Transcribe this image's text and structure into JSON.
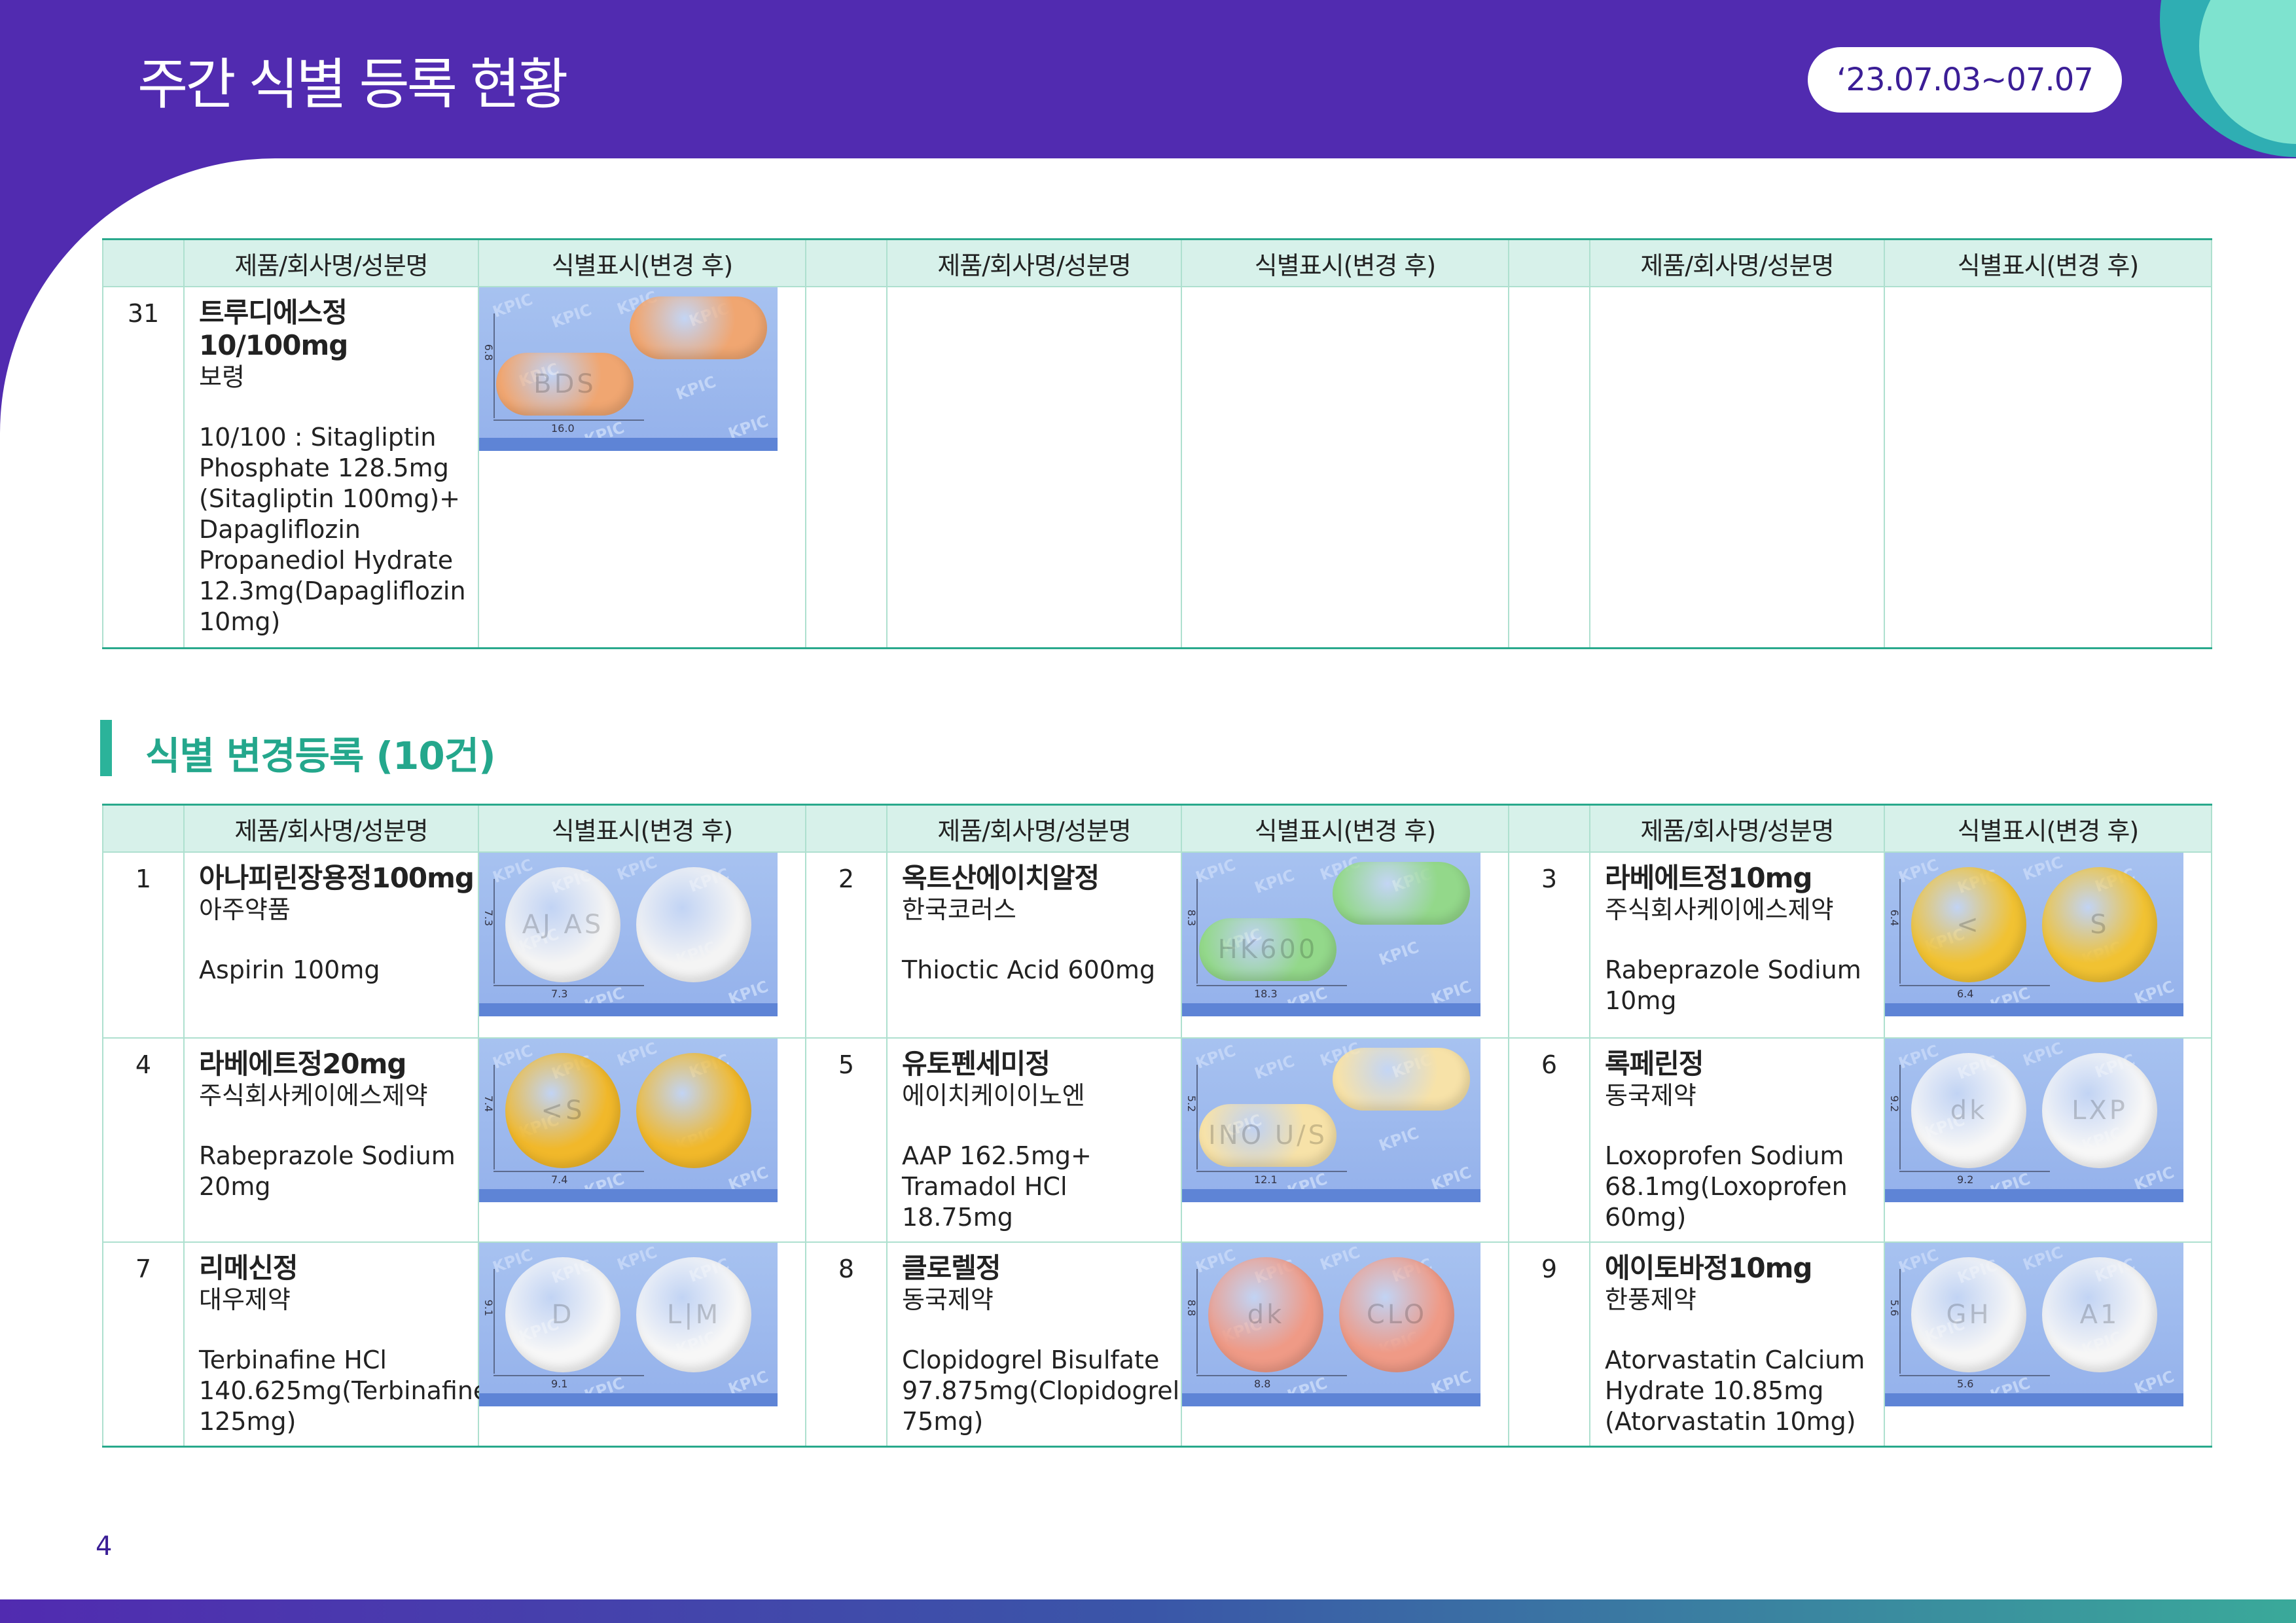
{
  "header": {
    "title": "주간 식별 등록 현황",
    "date_range": "‘23.07.03~07.07"
  },
  "columns": {
    "product": "제품/회사명/성분명",
    "marking": "식별표시(변경 후)"
  },
  "table1": {
    "rows": [
      {
        "num": "31",
        "name": "트루디에스정 10/100mg",
        "company": "보령",
        "ingredient": "10/100 : Sitagliptin Phosphate 128.5mg (Sitagliptin 100mg)+ Dapagliflozin Propanediol Hydrate 12.3mg(Dapagliflozin 10mg)",
        "photo": {
          "height_label": "6.8",
          "length_label": "16.0",
          "front_mark": "BDS",
          "back_mark": "",
          "shape": "oval",
          "color": "#f0a671"
        }
      }
    ]
  },
  "section2": {
    "title": "식별 변경등록 (10건)"
  },
  "table2": {
    "rows": [
      [
        {
          "num": "1",
          "name": "아나피린장용정100mg",
          "company": "아주약품",
          "ingredient": "Aspirin 100mg",
          "photo": {
            "height_label": "7.3",
            "length_label": "7.3",
            "front_mark": "AJ AS",
            "back_mark": "",
            "shape": "round",
            "color": "#f4f4f4"
          }
        },
        {
          "num": "2",
          "name": "옥트산에이치알정",
          "company": "한국코러스",
          "ingredient": "Thioctic Acid 600mg",
          "photo": {
            "height_label": "8.3",
            "length_label": "18.3",
            "front_mark": "HK600",
            "back_mark": "",
            "shape": "oval",
            "color": "#93d88a"
          }
        },
        {
          "num": "3",
          "name": "라베에트정10mg",
          "company": "주식회사케이에스제약",
          "ingredient": "Rabeprazole Sodium 10mg",
          "photo": {
            "height_label": "6.4",
            "length_label": "6.4",
            "front_mark": "<",
            "back_mark": "S",
            "shape": "round",
            "color": "#f1c232"
          }
        }
      ],
      [
        {
          "num": "4",
          "name": "라베에트정20mg",
          "company": "주식회사케이에스제약",
          "ingredient": "Rabeprazole Sodium 20mg",
          "photo": {
            "height_label": "7.4",
            "length_label": "7.4",
            "front_mark": "<S",
            "back_mark": "",
            "shape": "round",
            "color": "#f1b82a"
          }
        },
        {
          "num": "5",
          "name": "유토펜세미정",
          "company": "에이치케이이노엔",
          "ingredient": "AAP 162.5mg+ Tramadol HCl 18.75mg",
          "photo": {
            "height_label": "5.2",
            "length_label": "12.1",
            "front_mark": "INO U/S",
            "back_mark": "",
            "shape": "oval",
            "color": "#f7e2a8"
          }
        },
        {
          "num": "6",
          "name": "록페린정",
          "company": "동국제약",
          "ingredient": "Loxoprofen Sodium 68.1mg(Loxoprofen 60mg)",
          "photo": {
            "height_label": "9.2",
            "length_label": "9.2",
            "front_mark": "dk",
            "back_mark": "LXP",
            "shape": "round",
            "color": "#f7f7f7"
          }
        }
      ],
      [
        {
          "num": "7",
          "name": "리메신정",
          "company": "대우제약",
          "ingredient": "Terbinafine HCl 140.625mg(Terbinafine 125mg)",
          "photo": {
            "height_label": "9.1",
            "length_label": "9.1",
            "front_mark": "D",
            "back_mark": "L|M",
            "shape": "round",
            "color": "#f7f7f7"
          }
        },
        {
          "num": "8",
          "name": "클로렐정",
          "company": "동국제약",
          "ingredient": "Clopidogrel Bisulfate 97.875mg(Clopidogrel 75mg)",
          "photo": {
            "height_label": "8.8",
            "length_label": "8.8",
            "front_mark": "dk",
            "back_mark": "CLO",
            "shape": "round",
            "color": "#ef9a86"
          }
        },
        {
          "num": "9",
          "name": "에이토바정10mg",
          "company": "한풍제약",
          "ingredient": "Atorvastatin Calcium Hydrate 10.85mg (Atorvastatin 10mg)",
          "photo": {
            "height_label": "5.6",
            "length_label": "5.6",
            "front_mark": "GH",
            "back_mark": "A1",
            "shape": "round",
            "color": "#f6f6f6"
          }
        }
      ]
    ]
  },
  "page_number": "4"
}
